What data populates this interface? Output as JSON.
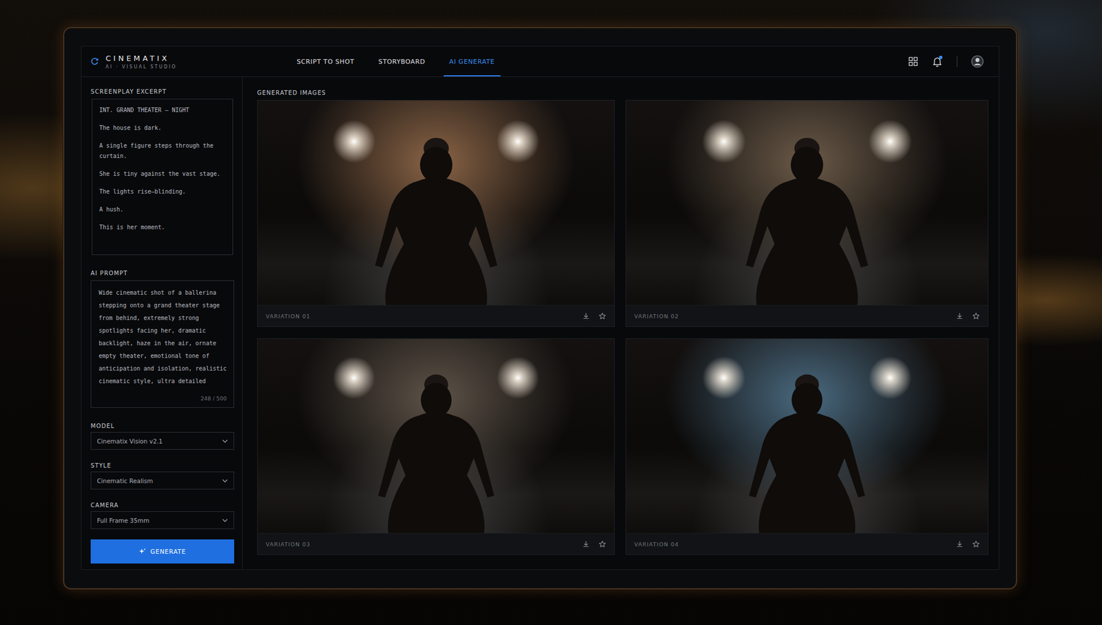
{
  "brand": {
    "name": "CINEMATIX",
    "tagline": "AI · VISUAL STUDIO"
  },
  "tabs": [
    {
      "label": "SCRIPT TO SHOT",
      "selected": false
    },
    {
      "label": "STORYBOARD",
      "selected": false
    },
    {
      "label": "AI GENERATE",
      "selected": true
    }
  ],
  "header": {
    "notifications_unread": true
  },
  "screenplay": {
    "label": "SCREENPLAY EXCERPT",
    "lines": [
      "INT. GRAND THEATER – NIGHT",
      "The house is dark.",
      "A single figure steps through the curtain.",
      "She is tiny against the vast stage.",
      "The lights rise—blinding.",
      "A hush.",
      "This is her moment."
    ]
  },
  "prompt": {
    "label": "AI PROMPT",
    "text": "Wide cinematic shot of a ballerina stepping onto a grand theater stage from behind, extremely strong spotlights facing her, dramatic backlight, haze in the air, ornate empty theater, emotional tone of anticipation and isolation, realistic cinematic style, ultra detailed",
    "counter": "248 / 500"
  },
  "settings": [
    {
      "label": "MODEL",
      "value": "Cinematix Vision v2.1"
    },
    {
      "label": "STYLE",
      "value": "Cinematic Realism"
    },
    {
      "label": "CAMERA",
      "value": "Full Frame 35mm"
    }
  ],
  "generate_button": "GENERATE",
  "gallery": {
    "label": "GENERATED IMAGES",
    "variations": [
      {
        "label": "VARIATION 01",
        "starred": false,
        "color": "#8a6446"
      },
      {
        "label": "VARIATION 02",
        "starred": false,
        "color": "#6b5a48"
      },
      {
        "label": "VARIATION 03",
        "starred": false,
        "color": "#5e5348"
      },
      {
        "label": "VARIATION 04",
        "starred": false,
        "color": "#4a6a80"
      }
    ]
  }
}
